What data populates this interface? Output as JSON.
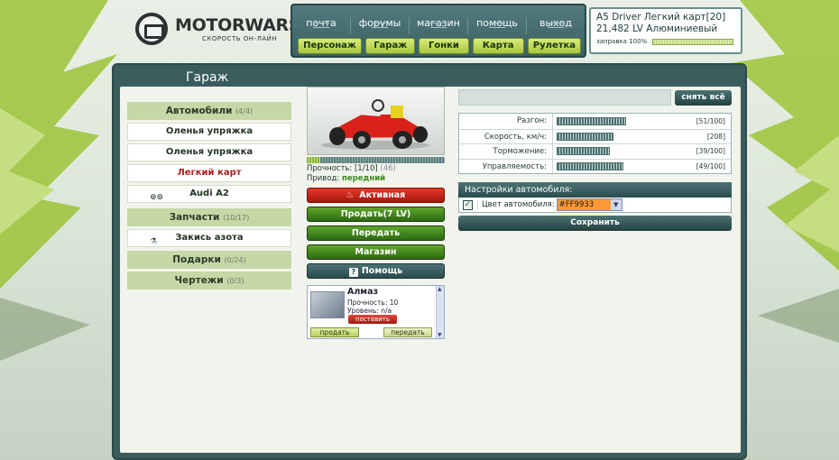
{
  "brand": {
    "title": "MOTORWARS.RU",
    "subtitle": "СКОРОСТЬ ОН-ЛАЙН"
  },
  "top_links": [
    "почта",
    "форумы",
    "магазин",
    "помощь",
    "выход"
  ],
  "nav_buttons": [
    "Персонаж",
    "Гараж",
    "Гонки",
    "Карта",
    "Рулетка"
  ],
  "car_info": {
    "line1": "A5 Driver Легкий карт[20]",
    "line2": "21,482 LV Алюминиевый",
    "fuel_label": "заправка 100%",
    "fuel_percent": 100
  },
  "page_title": "Гараж",
  "left_menu": {
    "cars": {
      "label": "Автомобили",
      "count": "(4/4)"
    },
    "car_items": [
      "Оленья упряжка",
      "Оленья упряжка",
      "Легкий карт",
      "Audi A2"
    ],
    "audi_logo_text": "Audi",
    "parts": {
      "label": "Запчасти",
      "count": "(10/17)"
    },
    "part_items": [
      "Закись азота"
    ],
    "gifts": {
      "label": "Подарки",
      "count": "(0/24)"
    },
    "blueprints": {
      "label": "Чертежи",
      "count": "(0/3)"
    }
  },
  "vehicle": {
    "durability_label": "Прочность:",
    "durability_value": "[1/10]",
    "durability_extra": "(46)",
    "durability_fraction": 0.1,
    "drive_label": "Привод:",
    "drive_value": "передний",
    "buttons": {
      "active": "Активная",
      "sell": "Продать(7 LV)",
      "transfer": "Передать",
      "shop": "Магазин",
      "help": "Помощь"
    }
  },
  "inventory_item": {
    "name": "Алмаз",
    "durability": "Прочность: 10",
    "level": "Уровень: n/a",
    "install": "поставить",
    "sell": "продать",
    "give": "передать"
  },
  "reset_button": "снять всё",
  "stats": [
    {
      "label": "Разгон:",
      "value": "[51/100]",
      "fraction": 0.51
    },
    {
      "label": "Скорость, км/ч:",
      "value": "[208]",
      "fraction": 0.42
    },
    {
      "label": "Торможение:",
      "value": "[39/100]",
      "fraction": 0.39
    },
    {
      "label": "Управляемость:",
      "value": "[49/100]",
      "fraction": 0.49
    }
  ],
  "settings": {
    "header": "Настройки автомобиля:",
    "color_label": "Цвет автомобиля:",
    "color_value": "#FF9933",
    "save": "Сохранить"
  },
  "colors": {
    "accent_teal": "#3a5c5d",
    "accent_green": "#a7c63c",
    "alert_red": "#b01c1c"
  }
}
